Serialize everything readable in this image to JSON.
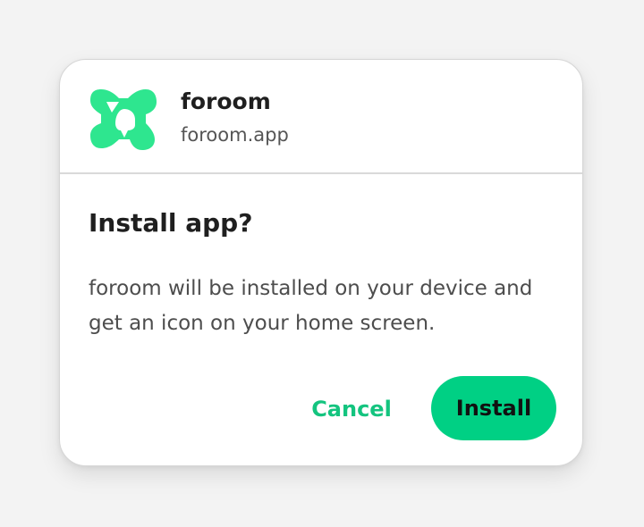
{
  "app": {
    "name": "foroom",
    "url": "foroom.app",
    "icon": "foroom-logo-icon",
    "brand_color": "#2ee68f"
  },
  "dialog": {
    "title": "Install app?",
    "message": "foroom will be installed on your device and get an icon on your home screen."
  },
  "actions": {
    "cancel_label": "Cancel",
    "install_label": "Install",
    "accent_color": "#00d084"
  }
}
